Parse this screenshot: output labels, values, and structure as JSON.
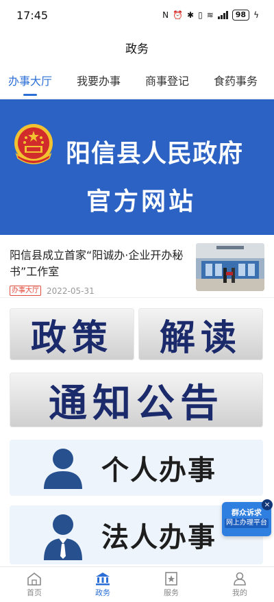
{
  "status": {
    "time": "17:45",
    "battery": "98"
  },
  "header": {
    "title": "政务"
  },
  "tabs": [
    {
      "label": "办事大厅",
      "active": true
    },
    {
      "label": "我要办事",
      "active": false
    },
    {
      "label": "商事登记",
      "active": false
    },
    {
      "label": "食药事务",
      "active": false
    }
  ],
  "banner": {
    "line1": "阳信县人民政府",
    "line2": "官方网站"
  },
  "news": {
    "title": "阳信县成立首家“阳诚办·企业开办秘书”工作室",
    "tag": "办事大厅",
    "date": "2022-05-31"
  },
  "cards": {
    "policy_left": "政策",
    "policy_right": "解读",
    "notice": "通知公告",
    "personal": "个人办事",
    "legal": "法人办事"
  },
  "float_badge": {
    "line1": "群众诉求",
    "line2": "网上办理平台",
    "close": "×"
  },
  "bottom_nav": [
    {
      "label": "首页",
      "icon": "home-icon"
    },
    {
      "label": "政务",
      "icon": "government-icon",
      "active": true
    },
    {
      "label": "服务",
      "icon": "star-bookmark-icon"
    },
    {
      "label": "我的",
      "icon": "person-icon"
    }
  ],
  "colors": {
    "accent": "#2b6fd6",
    "banner": "#2c62c4",
    "tag_red": "#e04a3b",
    "card_text": "#1b2a6b"
  }
}
